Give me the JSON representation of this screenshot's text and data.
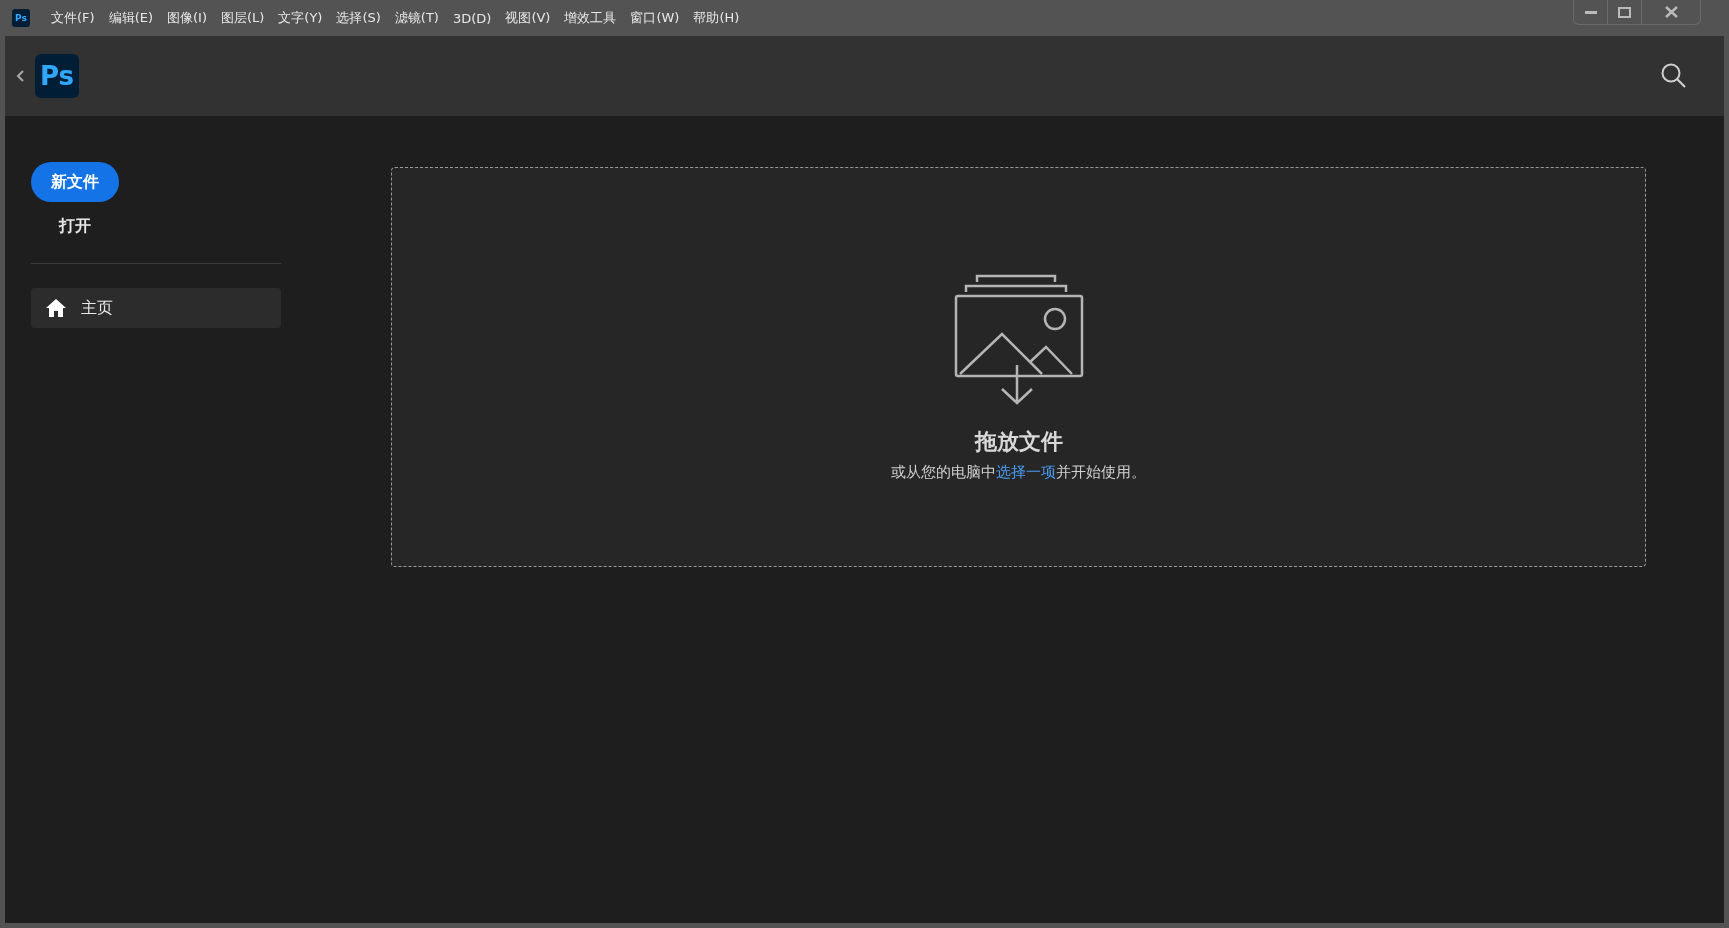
{
  "menu_bar": {
    "app_icon": "Ps",
    "items": [
      "文件(F)",
      "编辑(E)",
      "图像(I)",
      "图层(L)",
      "文字(Y)",
      "选择(S)",
      "滤镜(T)",
      "3D(D)",
      "视图(V)",
      "增效工具",
      "窗口(W)",
      "帮助(H)"
    ]
  },
  "header": {
    "logo": "Ps"
  },
  "sidebar": {
    "new_file_button": "新文件",
    "open_button": "打开",
    "nav": [
      {
        "label": "主页",
        "selected": true
      }
    ]
  },
  "drop_zone": {
    "title": "拖放文件",
    "hint_before": "或从您的电脑中",
    "link": "选择一项",
    "hint_after": "并开始使用。"
  }
}
